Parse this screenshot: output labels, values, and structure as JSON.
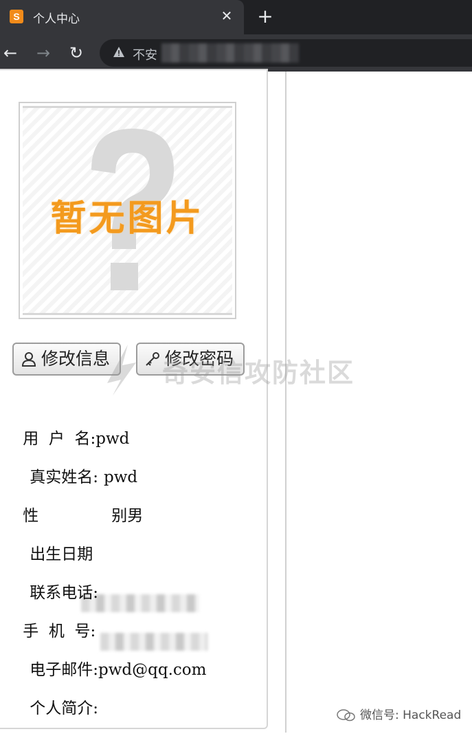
{
  "browser": {
    "tab_title": "个人中心",
    "favicon": "S",
    "close_glyph": "✕",
    "new_tab_glyph": "+",
    "insecure_label": "不安",
    "back_glyph": "←",
    "forward_glyph": "→",
    "reload_glyph": "↻"
  },
  "avatar": {
    "placeholder_text": "暂无图片"
  },
  "actions": {
    "edit_info_label": "修改信息",
    "change_password_label": "修改密码"
  },
  "profile": {
    "username_label": "用  户  名:",
    "username_value": "pwd",
    "realname_label": "真实姓名:",
    "realname_value": "pwd",
    "gender_label": "性",
    "gender_value": "别男",
    "birthday_label": "出生日期",
    "phone_label": "联系电话:",
    "mobile_label": "手  机  号:",
    "email_label": "电子邮件:",
    "email_value": "pwd@qq.com",
    "bio_label": "个人简介:"
  },
  "watermark": {
    "text": "奇安信攻防社区",
    "wechat": "微信号: HackRead"
  },
  "colors": {
    "chrome_dark": "#202124",
    "chrome_tab": "#35363a",
    "placeholder_orange": "#f39a1e"
  }
}
